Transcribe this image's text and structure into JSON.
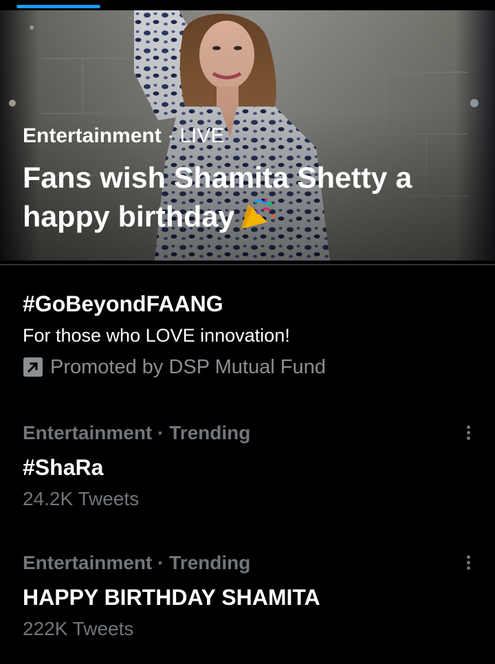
{
  "hero": {
    "category": "Entertainment",
    "separator": " · ",
    "live_label": "LIVE",
    "title": "Fans wish Shamita Shetty a happy birthday"
  },
  "promoted": {
    "hashtag": "#GoBeyondFAANG",
    "description": "For those who LOVE innovation!",
    "promoted_by": "Promoted by DSP Mutual Fund"
  },
  "trends": [
    {
      "meta": "Entertainment · Trending",
      "title": "#ShaRa",
      "count": "24.2K Tweets"
    },
    {
      "meta": "Entertainment · Trending",
      "title": "HAPPY BIRTHDAY SHAMITA",
      "count": "222K Tweets"
    }
  ],
  "colors": {
    "background": "#000000",
    "accent": "#1d9bf0",
    "muted_text": "#71767b",
    "primary_text": "#ffffff"
  },
  "icons": {
    "hero_emoji": "party-popper-icon",
    "promoted": "promoted-arrow-icon",
    "more": "more-options-icon"
  }
}
